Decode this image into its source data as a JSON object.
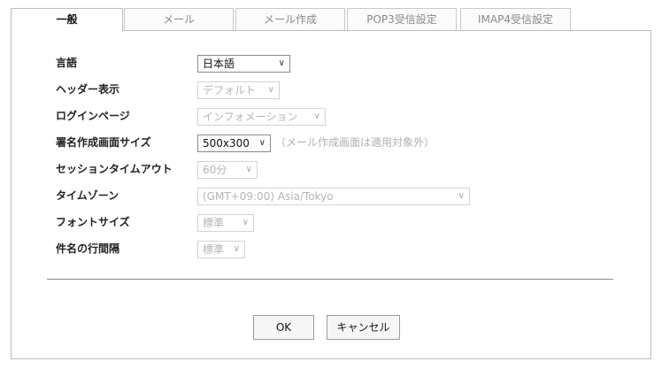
{
  "tabs": [
    {
      "label": "一般",
      "active": true
    },
    {
      "label": "メール",
      "active": false
    },
    {
      "label": "メール作成",
      "active": false
    },
    {
      "label": "POP3受信設定",
      "active": false
    },
    {
      "label": "IMAP4受信設定",
      "active": false
    }
  ],
  "settings": {
    "language": {
      "label": "言語",
      "value": "日本語",
      "enabled": true
    },
    "header_display": {
      "label": "ヘッダー表示",
      "value": "デフォルト",
      "enabled": false
    },
    "login_page": {
      "label": "ログインページ",
      "value": "インフォメーション",
      "enabled": false
    },
    "signature_screen_size": {
      "label": "署名作成画面サイズ",
      "value": "500x300",
      "enabled": true,
      "note": "（メール作成画面は適用対象外）"
    },
    "session_timeout": {
      "label": "セッションタイムアウト",
      "value": "60分",
      "enabled": false
    },
    "timezone": {
      "label": "タイムゾーン",
      "value": "(GMT+09:00) Asia/Tokyo",
      "enabled": false
    },
    "font_size": {
      "label": "フォントサイズ",
      "value": "標準",
      "enabled": false
    },
    "subject_line_spacing": {
      "label": "件名の行間隔",
      "value": "標準",
      "enabled": false
    }
  },
  "buttons": {
    "ok": "OK",
    "cancel": "キャンセル"
  },
  "icons": {
    "dropdown": "chevron-down-icon"
  },
  "colors": {
    "border": "#bdbdbd",
    "disabled_text": "#b4b4b4",
    "divider": "#8a8a8a"
  }
}
